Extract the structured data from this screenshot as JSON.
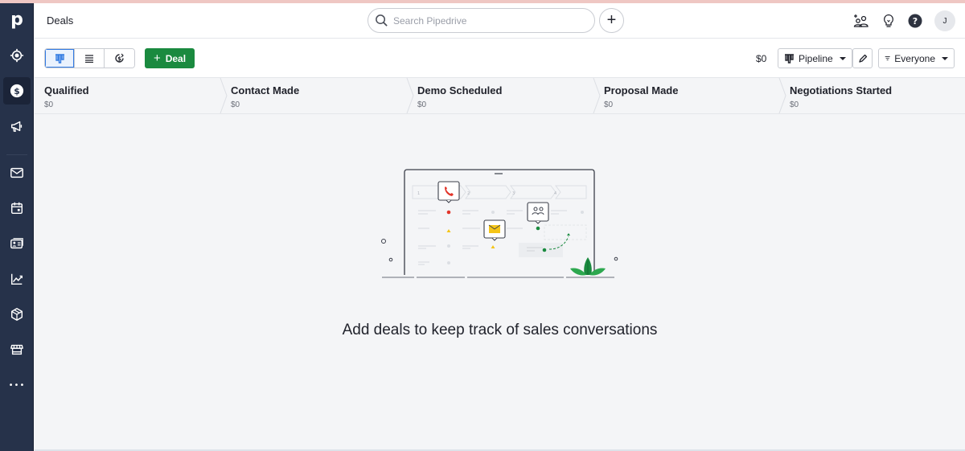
{
  "app": {
    "title": "Deals"
  },
  "search": {
    "placeholder": "Search Pipedrive"
  },
  "header": {
    "add_label": "+",
    "avatar_initial": "J",
    "icons": [
      "invite-users-icon",
      "lightbulb-icon",
      "help-icon"
    ]
  },
  "sidebar": {
    "items": [
      {
        "name": "logo",
        "label": "p"
      },
      {
        "name": "leads",
        "icon": "target-icon"
      },
      {
        "name": "deals",
        "icon": "dollar-icon",
        "active": true
      },
      {
        "name": "campaigns",
        "icon": "megaphone-icon"
      },
      {
        "name": "mail",
        "icon": "mail-icon"
      },
      {
        "name": "activities",
        "icon": "calendar-icon"
      },
      {
        "name": "contacts",
        "icon": "contact-card-icon"
      },
      {
        "name": "insights",
        "icon": "chart-icon"
      },
      {
        "name": "products",
        "icon": "box-icon"
      },
      {
        "name": "marketplace",
        "icon": "store-icon"
      },
      {
        "name": "more",
        "icon": "more-icon",
        "label": "•••"
      }
    ]
  },
  "toolbar": {
    "views": [
      "pipeline-view",
      "list-view",
      "forecast-view"
    ],
    "add_deal_label": "Deal",
    "total": "$0",
    "pipeline_label": "Pipeline",
    "filter_label": "Everyone"
  },
  "stages": [
    {
      "name": "Qualified",
      "value": "$0"
    },
    {
      "name": "Contact Made",
      "value": "$0"
    },
    {
      "name": "Demo Scheduled",
      "value": "$0"
    },
    {
      "name": "Proposal Made",
      "value": "$0"
    },
    {
      "name": "Negotiations Started",
      "value": "$0"
    }
  ],
  "illustration": {
    "columns": [
      "1",
      "2",
      "3",
      "4"
    ]
  },
  "empty_state": {
    "message": "Add deals to keep track of sales conversations"
  },
  "colors": {
    "sidebar": "#26324a",
    "accent": "#1a8a3f",
    "active_blue": "#317ae2"
  }
}
